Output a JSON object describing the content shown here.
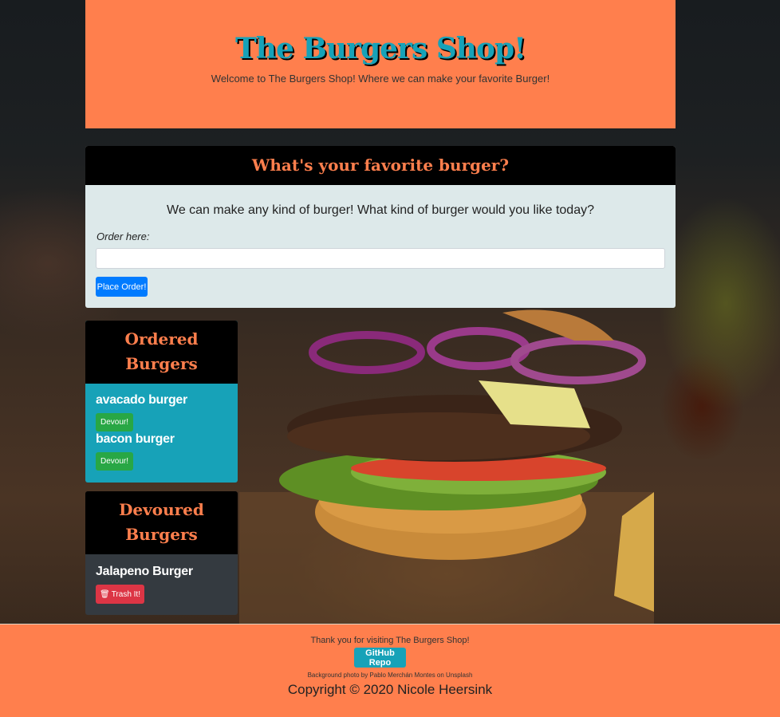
{
  "header": {
    "title": "The Burgers Shop!",
    "subtitle": "Welcome to The Burgers Shop! Where we can make your favorite Burger!"
  },
  "order_form": {
    "heading": "What's your favorite burger?",
    "prompt": "We can make any kind of burger! What kind of burger would you like today?",
    "label": "Order here:",
    "input_value": "",
    "submit_label": "Place Order!"
  },
  "ordered": {
    "heading_line1": "Ordered",
    "heading_line2": "Burgers",
    "items": [
      {
        "name": "avacado burger",
        "button_label": "Devour!"
      },
      {
        "name": "bacon burger",
        "button_label": "Devour!"
      }
    ]
  },
  "devoured": {
    "heading_line1": "Devoured",
    "heading_line2": "Burgers",
    "items": [
      {
        "name": "Jalapeno Burger",
        "button_label": "Trash It!",
        "icon": "trash-icon"
      }
    ]
  },
  "footer": {
    "thanks": "Thank you for visiting The Burgers Shop!",
    "github_label": "GitHub Repo",
    "credit": "Background photo by Pablo Merchán Montes on Unsplash",
    "copyright": "Copyright © 2020 Nicole Heersink"
  },
  "colors": {
    "accent_orange": "#ff7f4d",
    "teal": "#17a2b8",
    "primary_blue": "#007bff",
    "success_green": "#28a745",
    "danger_red": "#dc3545",
    "dark_gray": "#343a40"
  }
}
